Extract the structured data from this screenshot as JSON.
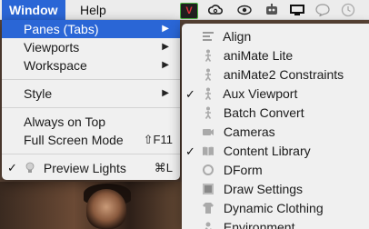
{
  "menubar": {
    "items": [
      {
        "label": "Window",
        "active": true
      },
      {
        "label": "Help",
        "active": false
      }
    ],
    "status_icons": [
      "visual-studio-icon",
      "creative-cloud-icon",
      "eye-icon",
      "robot-icon",
      "display-icon",
      "chat-bubble-icon",
      "time-machine-icon"
    ],
    "vs_glyph": "V"
  },
  "window_menu": {
    "items": [
      {
        "label": "Panes (Tabs)",
        "arrow": "▶",
        "highlight": true
      },
      {
        "label": "Viewports",
        "arrow": "▶"
      },
      {
        "label": "Workspace",
        "arrow": "▶"
      },
      {
        "separator": true
      },
      {
        "label": "Style",
        "arrow": "▶"
      },
      {
        "separator": true
      },
      {
        "label": "Always on Top"
      },
      {
        "label": "Full Screen Mode",
        "shortcut": "⇧F11"
      },
      {
        "separator": true
      },
      {
        "label": "Preview Lights",
        "checked": true,
        "shortcut": "⌘L",
        "icon": "lightbulb-icon"
      }
    ]
  },
  "panes_menu": {
    "items": [
      {
        "label": "Align",
        "icon": "align-icon"
      },
      {
        "label": "aniMate Lite",
        "icon": "figure-icon"
      },
      {
        "label": "aniMate2 Constraints",
        "icon": "figure-icon"
      },
      {
        "label": "Aux Viewport",
        "icon": "figure-icon",
        "checked": true
      },
      {
        "label": "Batch Convert",
        "icon": "figure-icon"
      },
      {
        "label": "Cameras",
        "icon": "camera-icon"
      },
      {
        "label": "Content Library",
        "icon": "book-icon",
        "checked": true
      },
      {
        "label": "DForm",
        "icon": "circle-icon"
      },
      {
        "label": "Draw Settings",
        "icon": "draw-settings-icon"
      },
      {
        "label": "Dynamic Clothing",
        "icon": "clothing-icon"
      },
      {
        "label": "Environment",
        "icon": "environment-icon"
      }
    ]
  },
  "glyphs": {
    "check": "✓"
  }
}
